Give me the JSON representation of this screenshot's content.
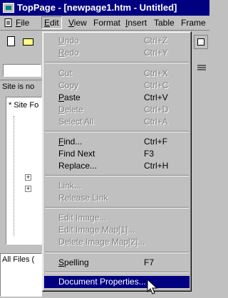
{
  "window": {
    "title": "TopPage - [newpage1.htm - Untitled]"
  },
  "menubar": {
    "items": [
      {
        "label": "File",
        "accel": "F",
        "rest": "ile"
      },
      {
        "label": "Edit",
        "accel": "E",
        "rest": "dit",
        "active": true
      },
      {
        "label": "View",
        "accel": "V",
        "rest": "iew"
      },
      {
        "label": "Format",
        "accel": "",
        "rest": "Format"
      },
      {
        "label": "Insert",
        "accel": "I",
        "rest": "nsert"
      },
      {
        "label": "Table",
        "accel": "",
        "rest": "Table"
      },
      {
        "label": "Frame",
        "accel": "",
        "rest": "Frame"
      }
    ]
  },
  "left_panel": {
    "status_text": "Site is no",
    "site_folder_label": "* Site Fo",
    "files_label": "All Files ("
  },
  "edit_menu": {
    "items": [
      {
        "accel": "U",
        "rest": "ndo",
        "shortcut": "Ctrl+Z",
        "enabled": false
      },
      {
        "accel": "R",
        "rest": "edo",
        "shortcut": "Ctrl+Y",
        "enabled": false
      },
      {
        "accel": "",
        "rest": "Cut",
        "shortcut": "Ctrl+X",
        "enabled": false
      },
      {
        "accel": "",
        "rest": "Copy",
        "shortcut": "Ctrl+C",
        "enabled": false
      },
      {
        "accel": "P",
        "rest": "aste",
        "shortcut": "Ctrl+V",
        "enabled": true
      },
      {
        "accel": "D",
        "rest": "elete",
        "shortcut": "Ctrl+D",
        "enabled": false
      },
      {
        "accel": "",
        "rest": "Select All",
        "shortcut": "Ctrl+A",
        "enabled": false
      },
      {
        "accel": "F",
        "rest": "ind...",
        "shortcut": "Ctrl+F",
        "enabled": true
      },
      {
        "accel": "",
        "rest": "Find Next",
        "shortcut": "F3",
        "enabled": true
      },
      {
        "accel": "",
        "rest": "Replace...",
        "shortcut": "Ctrl+H",
        "enabled": true
      },
      {
        "accel": "",
        "rest": "Link...",
        "shortcut": "",
        "enabled": false
      },
      {
        "accel": "",
        "rest": "Release Link",
        "shortcut": "",
        "enabled": false
      },
      {
        "accel": "",
        "rest": "Edit Image...",
        "shortcut": "",
        "enabled": false
      },
      {
        "accel": "",
        "rest": "Edit Image Map[1]...",
        "shortcut": "",
        "enabled": false
      },
      {
        "accel": "",
        "rest": "Delete Image Map[2]...",
        "shortcut": "",
        "enabled": false
      },
      {
        "accel": "S",
        "rest": "pelling",
        "shortcut": "F7",
        "enabled": true
      },
      {
        "accel": "",
        "rest": "Document Properties...",
        "shortcut": "",
        "enabled": true,
        "selected": true
      }
    ]
  },
  "colors": {
    "titlebar": "#000080",
    "face": "#c0c0c0",
    "highlight": "#000080",
    "disabled": "#808080"
  }
}
